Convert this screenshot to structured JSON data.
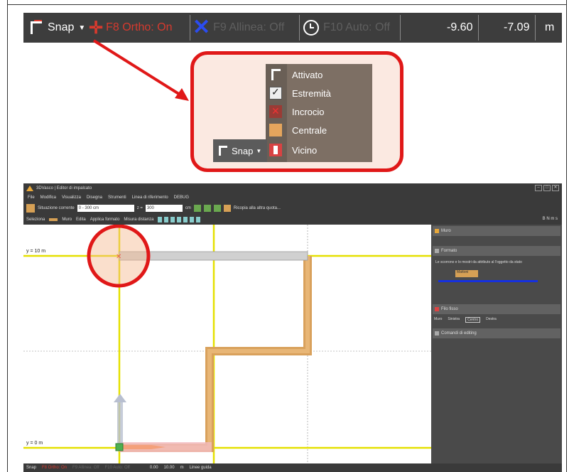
{
  "status_bar": {
    "snap_label": "Snap",
    "ortho_label": "F8 Ortho: On",
    "align_label": "F9 Allinea: Off",
    "auto_label": "F10 Auto: Off",
    "x_value": "-9.60",
    "y_value": "-7.09",
    "unit": "m",
    "colors": {
      "ortho": "#d63a2e",
      "align_icon": "#2b4cf0",
      "callout": "#e01818"
    }
  },
  "snap_menu": {
    "button_label": "Snap",
    "items": [
      {
        "label": "Attivato",
        "icon": "snap-icon"
      },
      {
        "label": "Estremità",
        "icon": "endpoint-check-icon"
      },
      {
        "label": "Incrocio",
        "icon": "intersection-icon"
      },
      {
        "label": "Centrale",
        "icon": "center-icon"
      },
      {
        "label": "Vicino",
        "icon": "nearest-icon"
      }
    ]
  },
  "app": {
    "title": "3DVasco | Editor di impalcato",
    "menu": [
      "File",
      "Modifica",
      "Visualizza",
      "Disegna",
      "Strumenti",
      "Linea di riferimento",
      "DEBUG"
    ],
    "toolbar1": {
      "section_label": "Situazione corrente",
      "section_value": "0 - 300 cm",
      "z_label": "z =",
      "z_value": "300",
      "z_unit": "cm",
      "copy_label": "Ricopia alla altra quota..."
    },
    "toolbar2": [
      "Seleziona",
      "Muro",
      "Edita",
      "Applica formato",
      "Misura distanza"
    ],
    "toolbar2_right": "B N m s",
    "canvas": {
      "label_top": "y = 10 m",
      "label_bottom": "y = 0 m"
    },
    "side_panel": {
      "header": "Muro",
      "section_format": "Formato",
      "format_hint": "Le scorrono e lo mostri da attributo al l'oggetto da stato",
      "format_name": "Mattoni",
      "section_thread": "Filo fisso",
      "thread_options": [
        "Muro",
        "Sinistra",
        "Centro",
        "Destra"
      ],
      "section_commands": "Comandi di editing"
    },
    "bottom_status": {
      "snap": "Snap",
      "ortho": "F8 Ortho: On",
      "align": "F9 Allinea: Off",
      "auto": "F10 Auto: Off",
      "x": "0.00",
      "y": "10.00",
      "unit": "m",
      "link": "Linee guida"
    }
  }
}
